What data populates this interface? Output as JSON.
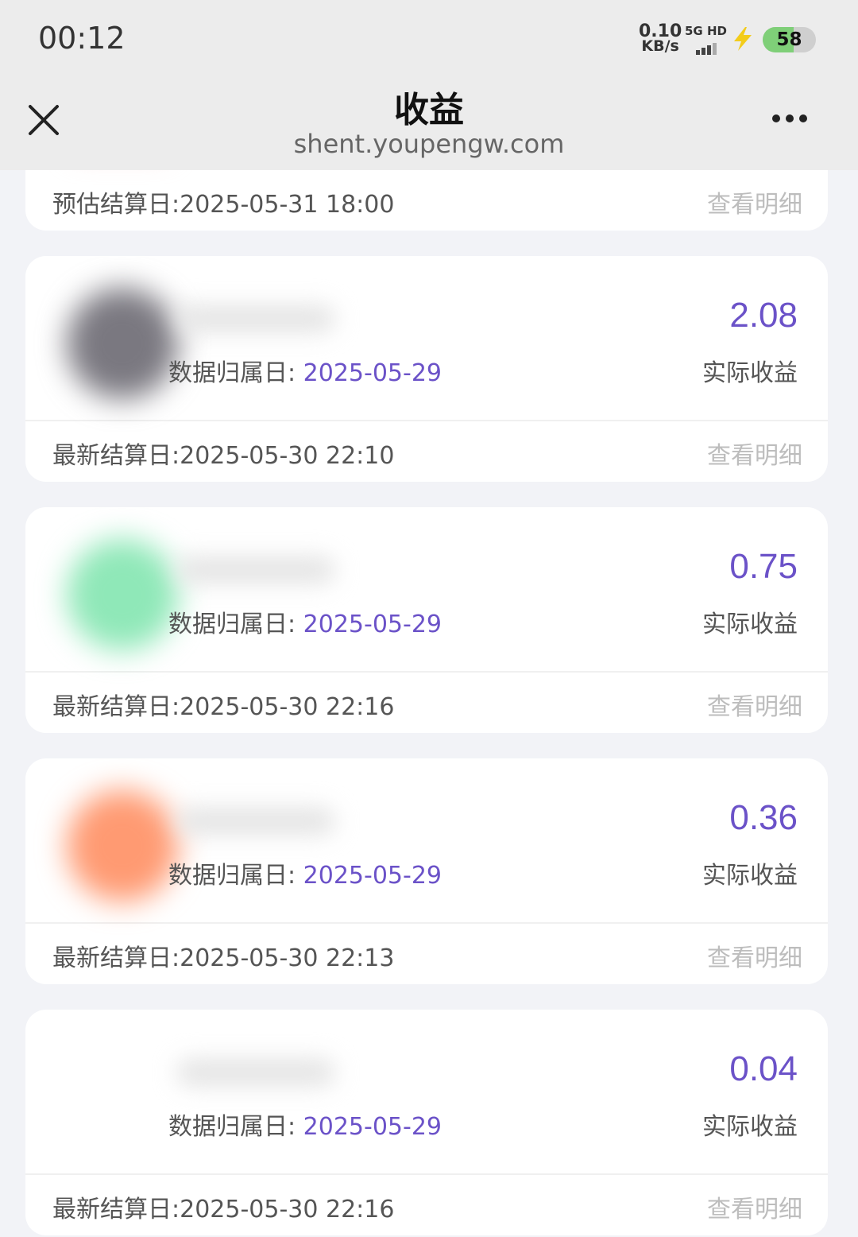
{
  "status_bar": {
    "time": "00:12",
    "net_speed_value": "0.10",
    "net_speed_unit": "KB/s",
    "network_label": "5G HD",
    "battery": "58"
  },
  "nav": {
    "title": "收益",
    "url": "shent.youpengw.com"
  },
  "partial_card": {
    "settle_text": "预估结算日:2025-05-31 18:00",
    "detail_label": "查看明细"
  },
  "cards": [
    {
      "logo_color": "#7a7880",
      "attr_label": "数据归属日: ",
      "attr_date": "2025-05-29",
      "amount": "2.08",
      "amount_label": "实际收益",
      "settle_text": "最新结算日:2025-05-30 22:10",
      "detail_label": "查看明细"
    },
    {
      "logo_color": "#8fe8b8",
      "attr_label": "数据归属日: ",
      "attr_date": "2025-05-29",
      "amount": "0.75",
      "amount_label": "实际收益",
      "settle_text": "最新结算日:2025-05-30 22:16",
      "detail_label": "查看明细"
    },
    {
      "logo_color": "#ff9a72",
      "attr_label": "数据归属日: ",
      "attr_date": "2025-05-29",
      "amount": "0.36",
      "amount_label": "实际收益",
      "settle_text": "最新结算日:2025-05-30 22:13",
      "detail_label": "查看明细"
    },
    {
      "logo_color": "#ffffff",
      "attr_label": "数据归属日: ",
      "attr_date": "2025-05-29",
      "amount": "0.04",
      "amount_label": "实际收益",
      "settle_text": "最新结算日:2025-05-30 22:16",
      "detail_label": "查看明细"
    }
  ],
  "colors": {
    "accent": "#6b52c8",
    "background": "#f2f3f7"
  }
}
